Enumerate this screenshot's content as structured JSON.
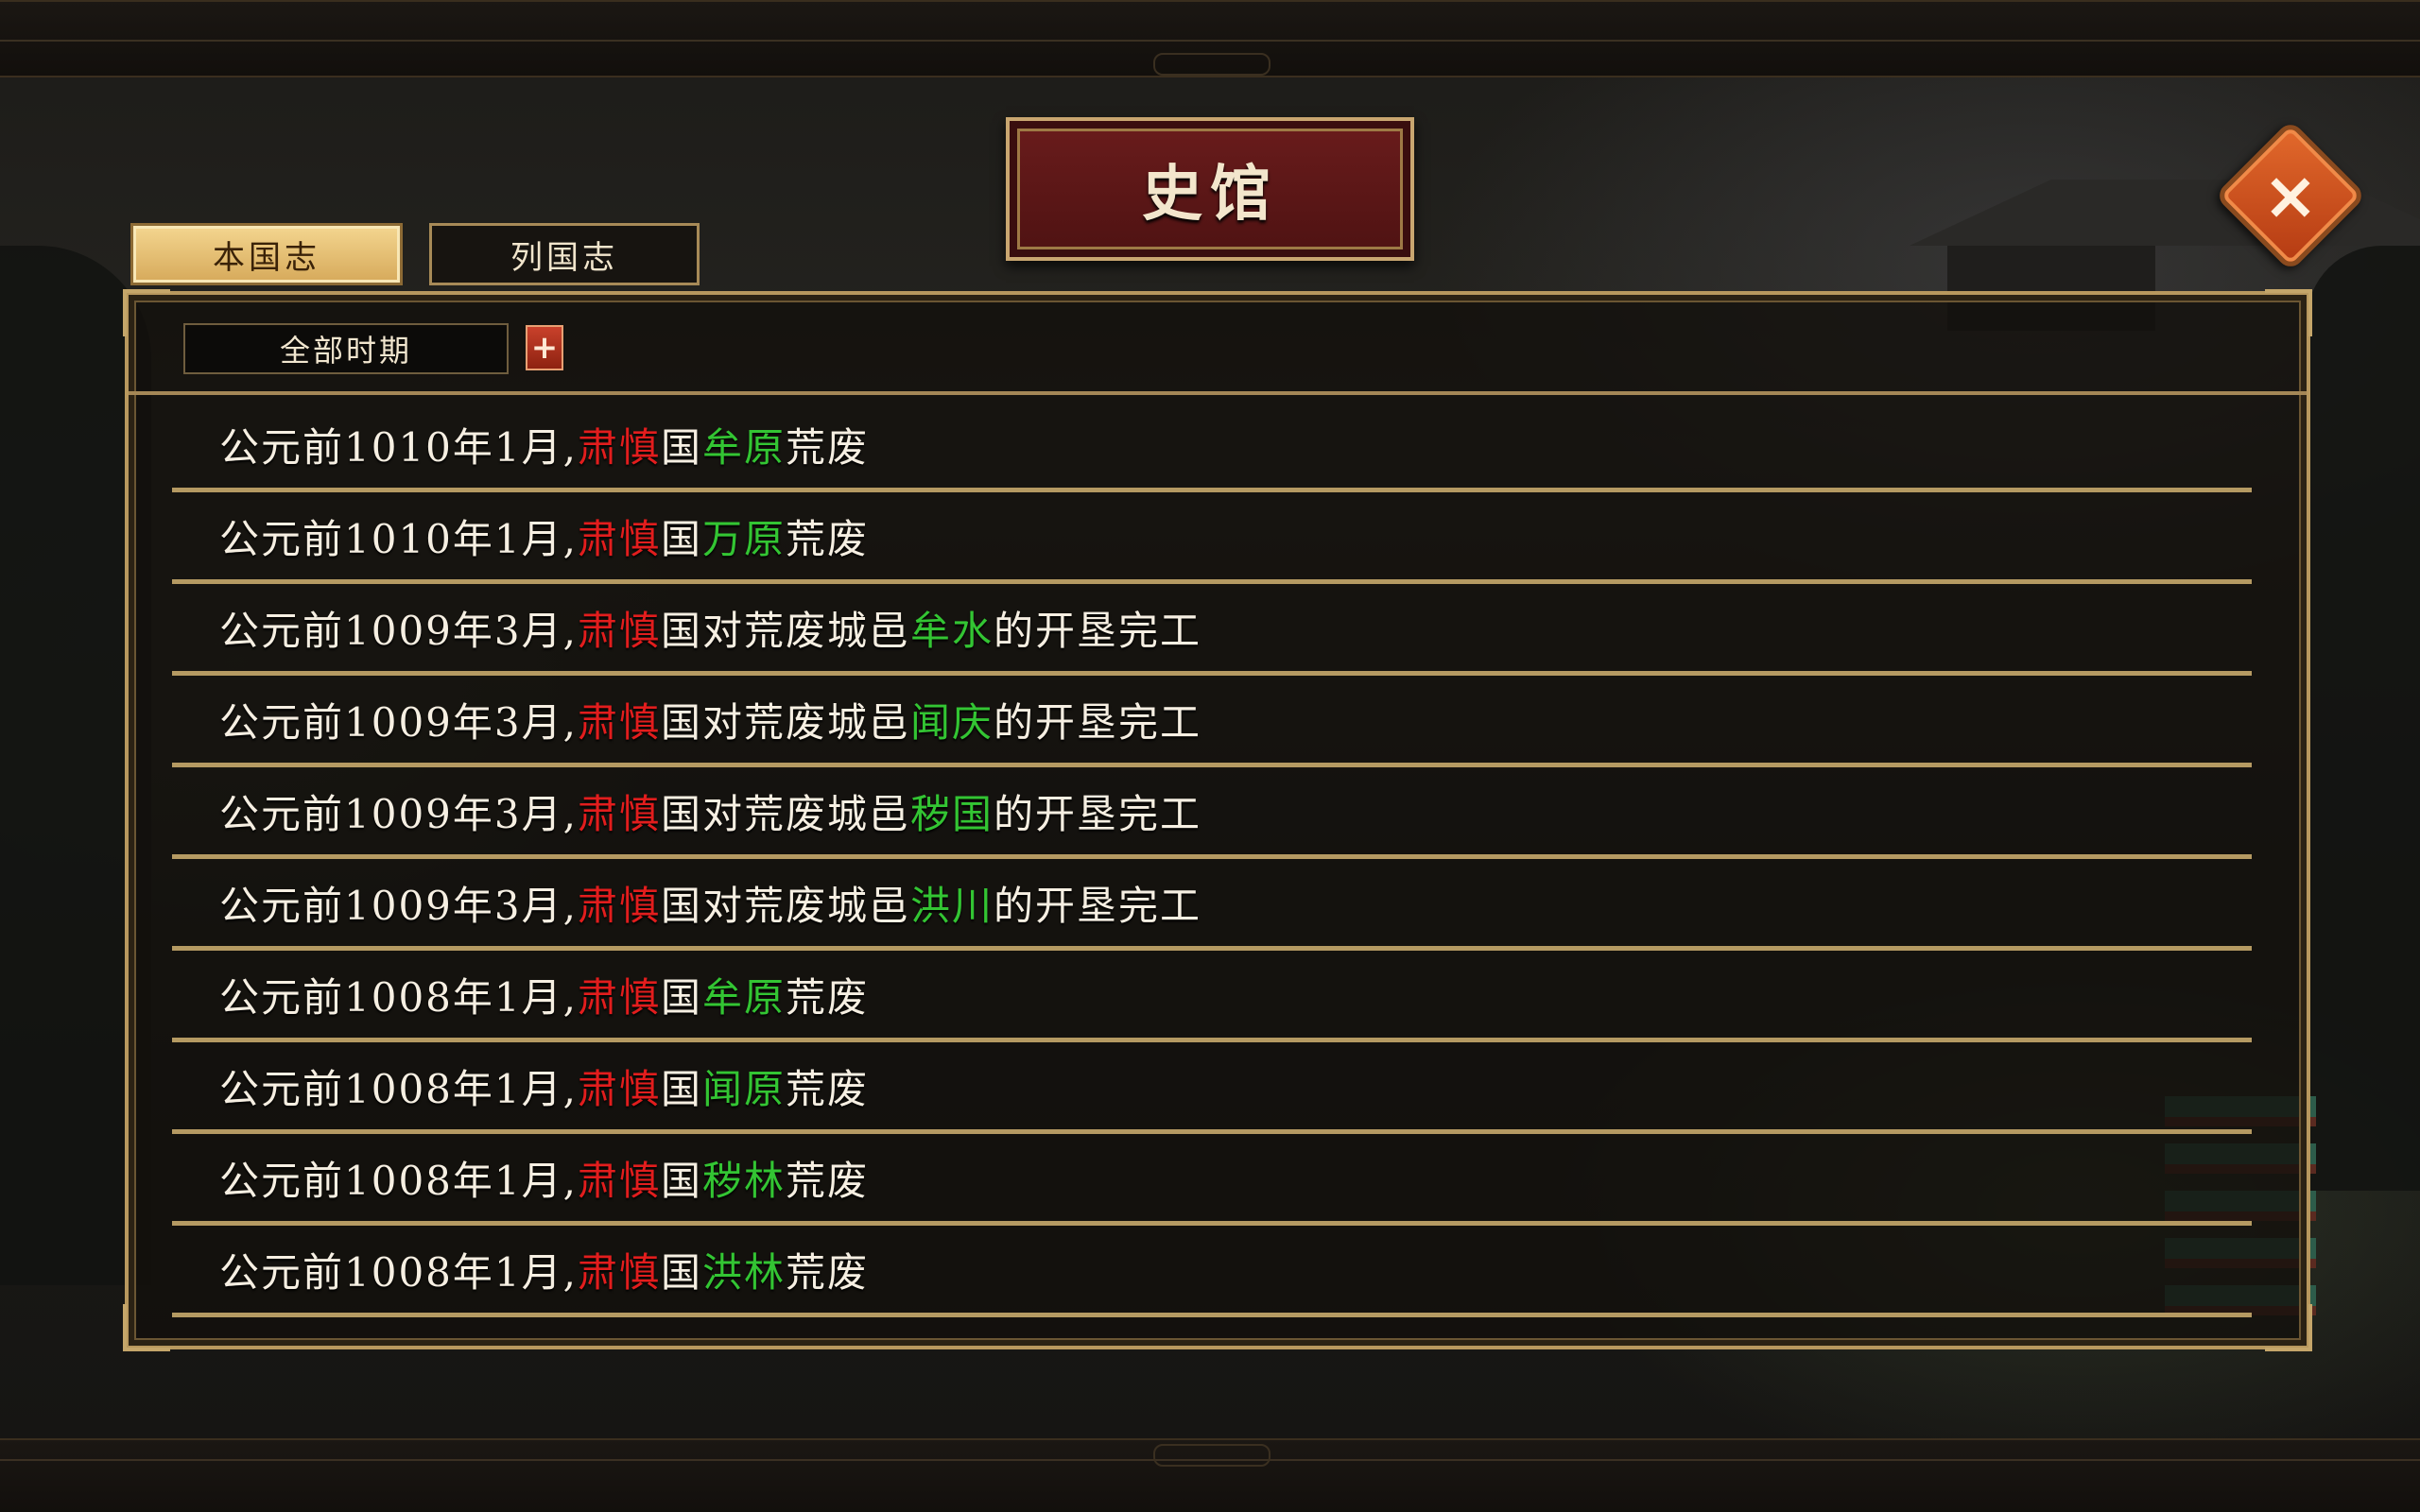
{
  "title": "史馆",
  "tabs": [
    {
      "label": "本国志",
      "active": true
    },
    {
      "label": "列国志",
      "active": false
    }
  ],
  "filter": {
    "label": "全部时期",
    "add_icon": "+"
  },
  "close_icon": "×",
  "colors": {
    "red": "#e21d1d",
    "green": "#33c533",
    "gold": "#b59a62"
  },
  "entries": [
    {
      "date": "公元前1010年1月,",
      "nation": "肃慎",
      "a": "国",
      "place": "牟原",
      "b": "荒废"
    },
    {
      "date": "公元前1010年1月,",
      "nation": "肃慎",
      "a": "国",
      "place": "万原",
      "b": "荒废"
    },
    {
      "date": "公元前1009年3月,",
      "nation": "肃慎",
      "a": "国对荒废城邑",
      "place": "牟水",
      "b": "的开垦完工"
    },
    {
      "date": "公元前1009年3月,",
      "nation": "肃慎",
      "a": "国对荒废城邑",
      "place": "闻庆",
      "b": "的开垦完工"
    },
    {
      "date": "公元前1009年3月,",
      "nation": "肃慎",
      "a": "国对荒废城邑",
      "place": "秽国",
      "b": "的开垦完工"
    },
    {
      "date": "公元前1009年3月,",
      "nation": "肃慎",
      "a": "国对荒废城邑",
      "place": "洪川",
      "b": "的开垦完工"
    },
    {
      "date": "公元前1008年1月,",
      "nation": "肃慎",
      "a": "国",
      "place": "牟原",
      "b": "荒废"
    },
    {
      "date": "公元前1008年1月,",
      "nation": "肃慎",
      "a": "国",
      "place": "闻原",
      "b": "荒废"
    },
    {
      "date": "公元前1008年1月,",
      "nation": "肃慎",
      "a": "国",
      "place": "秽林",
      "b": "荒废"
    },
    {
      "date": "公元前1008年1月,",
      "nation": "肃慎",
      "a": "国",
      "place": "洪林",
      "b": "荒废"
    }
  ]
}
